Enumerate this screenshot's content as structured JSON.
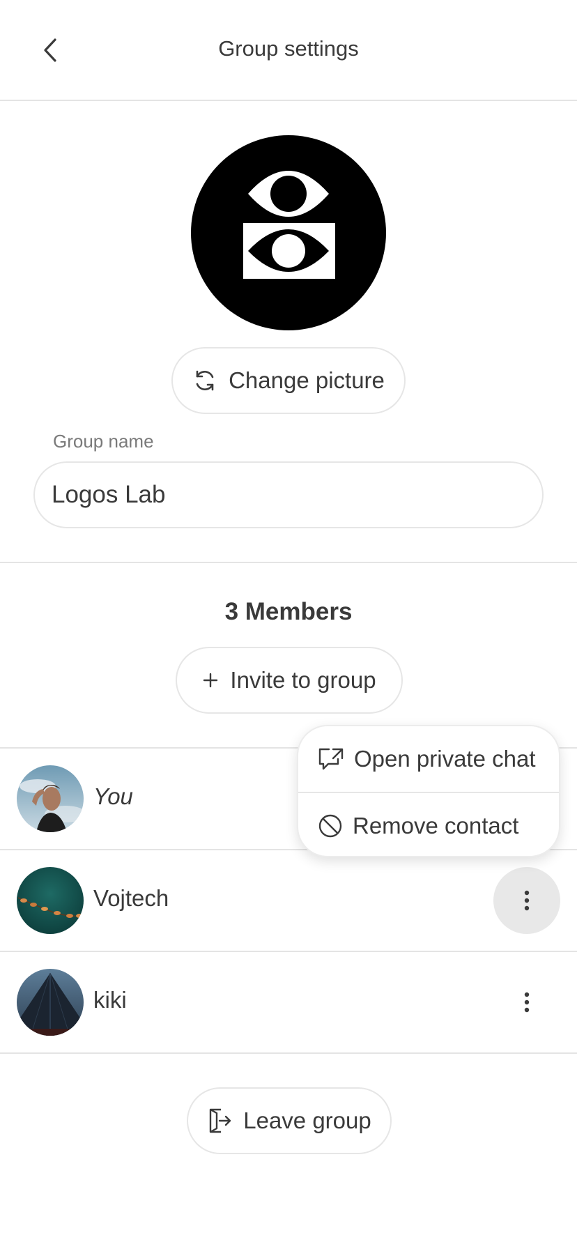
{
  "header": {
    "title": "Group settings",
    "back_icon": "chevron-left-icon"
  },
  "group": {
    "picture_icon": "logos-eyes-logo",
    "change_picture_label": "Change picture",
    "change_picture_icon": "refresh-icon",
    "name_label": "Group name",
    "name_value": "Logos Lab"
  },
  "members": {
    "title": "3 Members",
    "invite_label": "Invite to group",
    "invite_icon": "plus-icon",
    "list": [
      {
        "name": "You",
        "avatar": "avatar-photo-you"
      },
      {
        "name": "Vojtech",
        "avatar": "avatar-photo-vojtech"
      },
      {
        "name": "kiki",
        "avatar": "avatar-photo-kiki"
      }
    ]
  },
  "context_menu": {
    "items": [
      {
        "label": "Open private chat",
        "icon": "external-chat-icon"
      },
      {
        "label": "Remove contact",
        "icon": "block-icon"
      }
    ]
  },
  "footer": {
    "leave_label": "Leave group",
    "leave_icon": "exit-door-icon"
  },
  "colors": {
    "text": "#3a3a3a",
    "border": "#e6e6e6",
    "kebab_active": "#e8e8e8"
  }
}
